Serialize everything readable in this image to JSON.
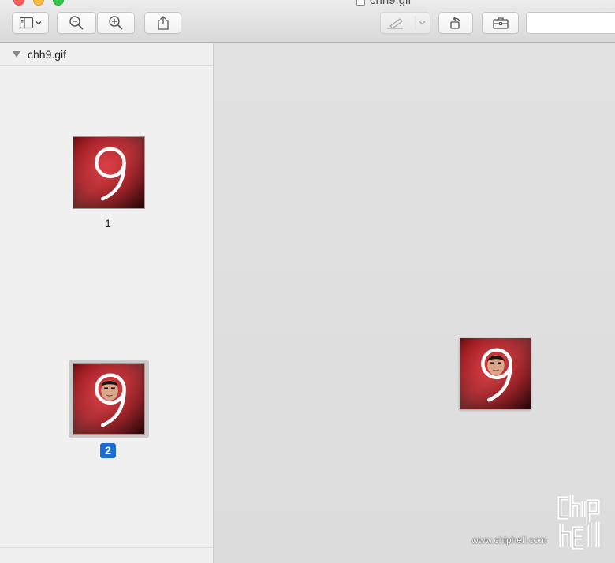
{
  "window": {
    "title": "chh9.gif"
  },
  "toolbar": {
    "buttons": [
      {
        "name": "sidebar-toggle",
        "icon": "sidebar-icon"
      },
      {
        "name": "zoom-out",
        "icon": "zoom-out-icon"
      },
      {
        "name": "zoom-in",
        "icon": "zoom-in-icon"
      },
      {
        "name": "share",
        "icon": "share-icon"
      },
      {
        "name": "markup",
        "icon": "pen-icon"
      },
      {
        "name": "rotate",
        "icon": "rotate-left-icon"
      },
      {
        "name": "toolbox",
        "icon": "toolbox-icon"
      }
    ]
  },
  "sidebar": {
    "file_name": "chh9.gif",
    "pages": [
      {
        "label": "1",
        "selected": false
      },
      {
        "label": "2",
        "selected": true
      }
    ]
  },
  "watermark": {
    "url": "www.chiphell.com",
    "logo_text": "chip hell"
  },
  "colors": {
    "accent": "#1d6dd6",
    "tile_red": "#b3161f"
  }
}
